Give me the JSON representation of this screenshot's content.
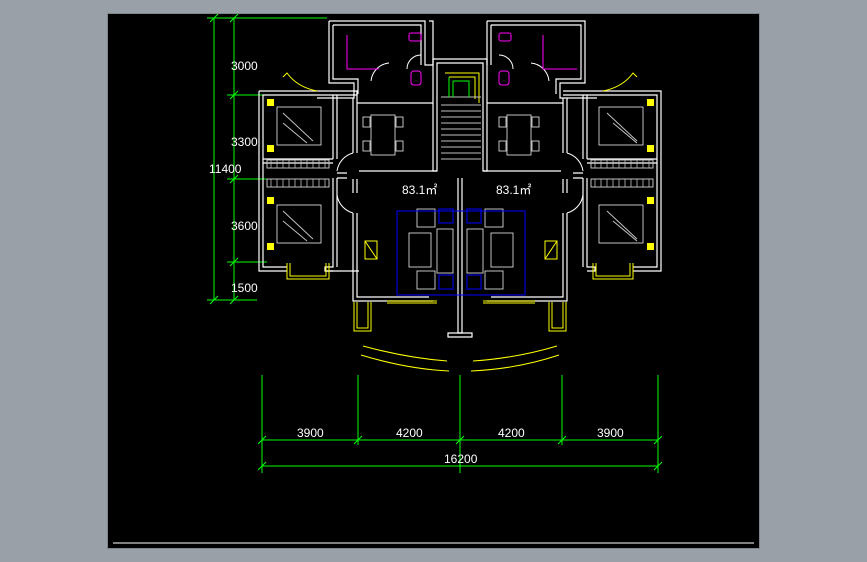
{
  "drawing": {
    "background": "#000000",
    "frame_color": "#9aa0a8",
    "wall_color": "#ffffff",
    "dim_color": "#00ff00",
    "window_color": "#ffff00",
    "furniture_color": "#c0c0c0",
    "sanitary_color": "#ff00ff",
    "sofa_color": "#0000ff"
  },
  "vertical_dims": {
    "d1": "3000",
    "d2": "3300",
    "total": "11400",
    "d3": "3600",
    "d4": "1500"
  },
  "horizontal_dims": {
    "d1": "3900",
    "d2": "4200",
    "d3": "4200",
    "d4": "3900",
    "total": "16200"
  },
  "areas": {
    "left_unit": "83.1㎡",
    "right_unit": "83.1㎡"
  }
}
